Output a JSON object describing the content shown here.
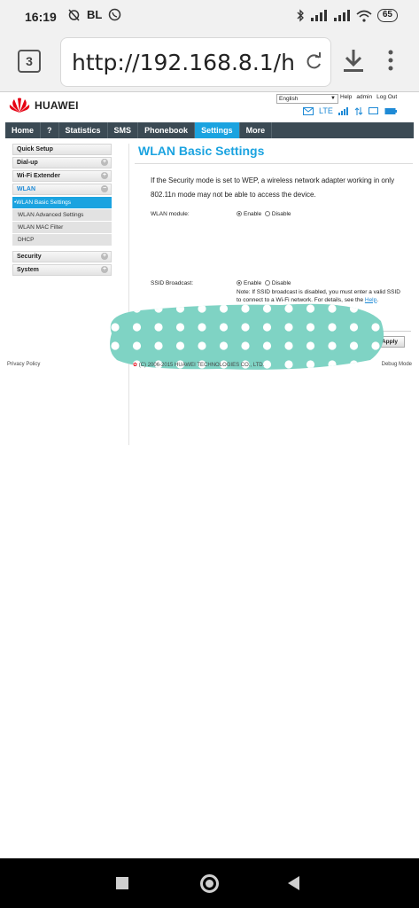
{
  "status_bar": {
    "time": "16:19",
    "carrier_badge": "BL",
    "battery": "65"
  },
  "browser": {
    "tab_count": "3",
    "url": "http://192.168.8.1/h"
  },
  "router": {
    "brand": "HUAWEI",
    "language": "English",
    "top_links": [
      "Help",
      "admin",
      "Log Out"
    ],
    "network_type": "LTE",
    "nav": [
      {
        "label": "Home"
      },
      {
        "label": "?"
      },
      {
        "label": "Statistics"
      },
      {
        "label": "SMS"
      },
      {
        "label": "Phonebook"
      },
      {
        "label": "Settings"
      },
      {
        "label": "More"
      }
    ],
    "sidebar": {
      "quick_setup": "Quick Setup",
      "dialup": "Dial-up",
      "wifi_extender": "Wi-Fi Extender",
      "wlan": "WLAN",
      "wlan_items": [
        "•WLAN Basic Settings",
        "WLAN Advanced Settings",
        "WLAN MAC Filter",
        "DHCP"
      ],
      "security": "Security",
      "system": "System"
    },
    "main": {
      "title": "WLAN Basic Settings",
      "description": "If the Security mode is set to WEP, a wireless network adapter working in only 802.11n mode may not be able to access the device.",
      "wlan_module_label": "WLAN module:",
      "ssid_broadcast_label": "SSID Broadcast:",
      "enable": "Enable",
      "disable": "Disable",
      "note_prefix": "Note: If SSID broadcast is disabled, you must enter a valid SSID to connect to a Wi-Fi network. For details, see the ",
      "note_link": "Help",
      "note_suffix": ".",
      "apply": "Apply"
    },
    "footer": {
      "privacy": "Privacy Policy",
      "copyright": "(C) 2006-2015 HUAWEI TECHNOLOGIES CO., LTD.",
      "debug": "Debug Mode"
    }
  },
  "colors": {
    "accent": "#1ba3e0",
    "navbar": "#3b4a54",
    "redaction": "#7fd3c4",
    "huawei_red": "#e60012"
  }
}
